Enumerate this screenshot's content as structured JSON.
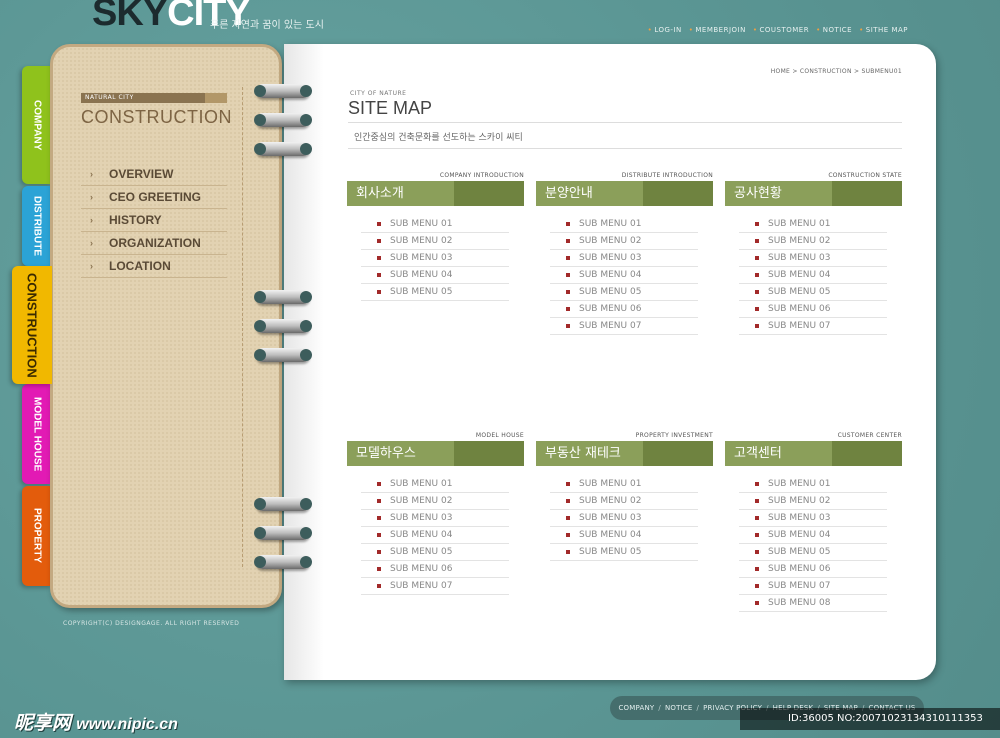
{
  "header": {
    "logo_sky": "SKY",
    "logo_city": "CITY",
    "tagline": "푸른 자연과 꿈이 있는 도시",
    "top_links": [
      "LOG-IN",
      "MEMBERJOIN",
      "COUSTOMER",
      "NOTICE",
      "SITHE MAP"
    ]
  },
  "tabs": {
    "company": "COMPANY",
    "distribute": "DISTRIBUTE",
    "construction": "CONSTRUCTION",
    "model_house": "MODEL HOUSE",
    "property": "PROPERTY"
  },
  "left_panel": {
    "tag": "NATURAL CITY",
    "title": "CONSTRUCTION",
    "menu": [
      "OVERVIEW",
      "CEO GREETING",
      "HISTORY",
      "ORGANIZATION",
      "LOCATION"
    ]
  },
  "copyright": "COPYRIGHT(C) DESIGNGAGE. ALL RIGHT RESERVED",
  "page": {
    "breadcrumb": "HOME > CONSTRUCTION > SUBMENU01",
    "sub": "CITY OF NATURE",
    "title": "SITE MAP",
    "desc": "인간중심의 건축문화를 선도하는 스카이 씨티"
  },
  "sections": [
    {
      "eng": "COMPANY INTRODUCTION",
      "title": "회사소개",
      "items": [
        "SUB MENU 01",
        "SUB MENU 02",
        "SUB MENU 03",
        "SUB MENU 04",
        "SUB MENU 05"
      ]
    },
    {
      "eng": "DISTRIBUTE INTRODUCTION",
      "title": "분양안내",
      "items": [
        "SUB MENU 01",
        "SUB MENU 02",
        "SUB MENU 03",
        "SUB MENU 04",
        "SUB MENU 05",
        "SUB MENU 06",
        "SUB MENU 07"
      ]
    },
    {
      "eng": "CONSTRUCTION STATE",
      "title": "공사현황",
      "items": [
        "SUB MENU 01",
        "SUB MENU 02",
        "SUB MENU 03",
        "SUB MENU 04",
        "SUB MENU 05",
        "SUB MENU 06",
        "SUB MENU 07"
      ]
    },
    {
      "eng": "MODEL HOUSE",
      "title": "모델하우스",
      "items": [
        "SUB MENU 01",
        "SUB MENU 02",
        "SUB MENU 03",
        "SUB MENU 04",
        "SUB MENU 05",
        "SUB MENU 06",
        "SUB MENU 07"
      ]
    },
    {
      "eng": "PROPERTY INVESTMENT",
      "title": "부동산 재테크",
      "items": [
        "SUB MENU 01",
        "SUB MENU 02",
        "SUB MENU 03",
        "SUB MENU 04",
        "SUB MENU 05"
      ]
    },
    {
      "eng": "CUSTOMER CENTER",
      "title": "고객센터",
      "items": [
        "SUB MENU 01",
        "SUB MENU 02",
        "SUB MENU 03",
        "SUB MENU 04",
        "SUB MENU 05",
        "SUB MENU 06",
        "SUB MENU 07",
        "SUB MENU 08"
      ]
    }
  ],
  "bottom_nav": [
    "COMPANY",
    "NOTICE",
    "PRIVACY POLICY",
    "HELP DESK",
    "SITE MAP",
    "CONTACT US"
  ],
  "watermark": {
    "text": "昵享网",
    "url": "www.nipic.cn",
    "id": "ID:36005 NO:20071023134310111353"
  },
  "colors": {
    "background": "#5e9a98",
    "section_bar": "#8b9f5a",
    "tab_company": "#8fc21c",
    "tab_distribute": "#2ba3d6",
    "tab_construction": "#f1b800",
    "tab_model_house": "#e21ab4",
    "tab_property": "#e35c0c"
  }
}
